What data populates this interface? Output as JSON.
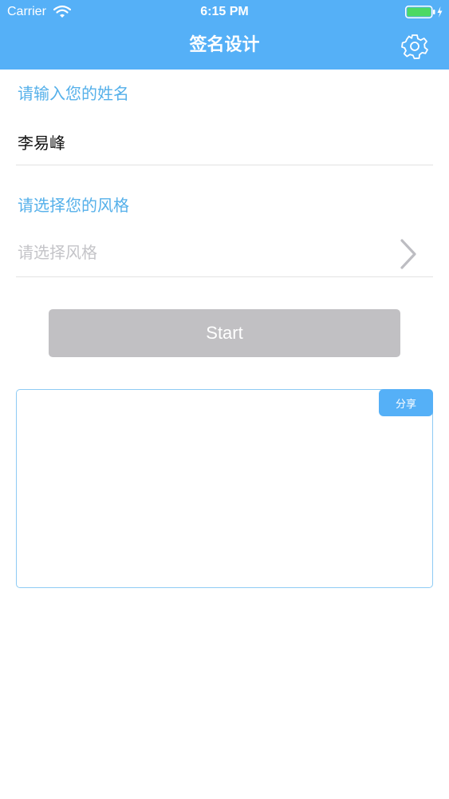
{
  "status_bar": {
    "carrier": "Carrier",
    "time": "6:15 PM",
    "icons": [
      "wifi-icon",
      "battery-charging-icon"
    ]
  },
  "nav": {
    "title": "签名设计",
    "settings_icon": "gear-icon"
  },
  "form": {
    "name_label": "请输入您的姓名",
    "name_value": "李易峰",
    "style_label": "请选择您的风格",
    "style_placeholder": "请选择风格",
    "chevron_icon": "chevron-right-icon"
  },
  "actions": {
    "start_label": "Start"
  },
  "signature_panel": {
    "share_label": "分享"
  },
  "colors": {
    "header_bg": "#55b0f7",
    "accent_text": "#55b0ea",
    "start_button_bg": "#c1c0c3",
    "panel_border": "#8ecbf4",
    "battery_fill": "#4cd964"
  }
}
